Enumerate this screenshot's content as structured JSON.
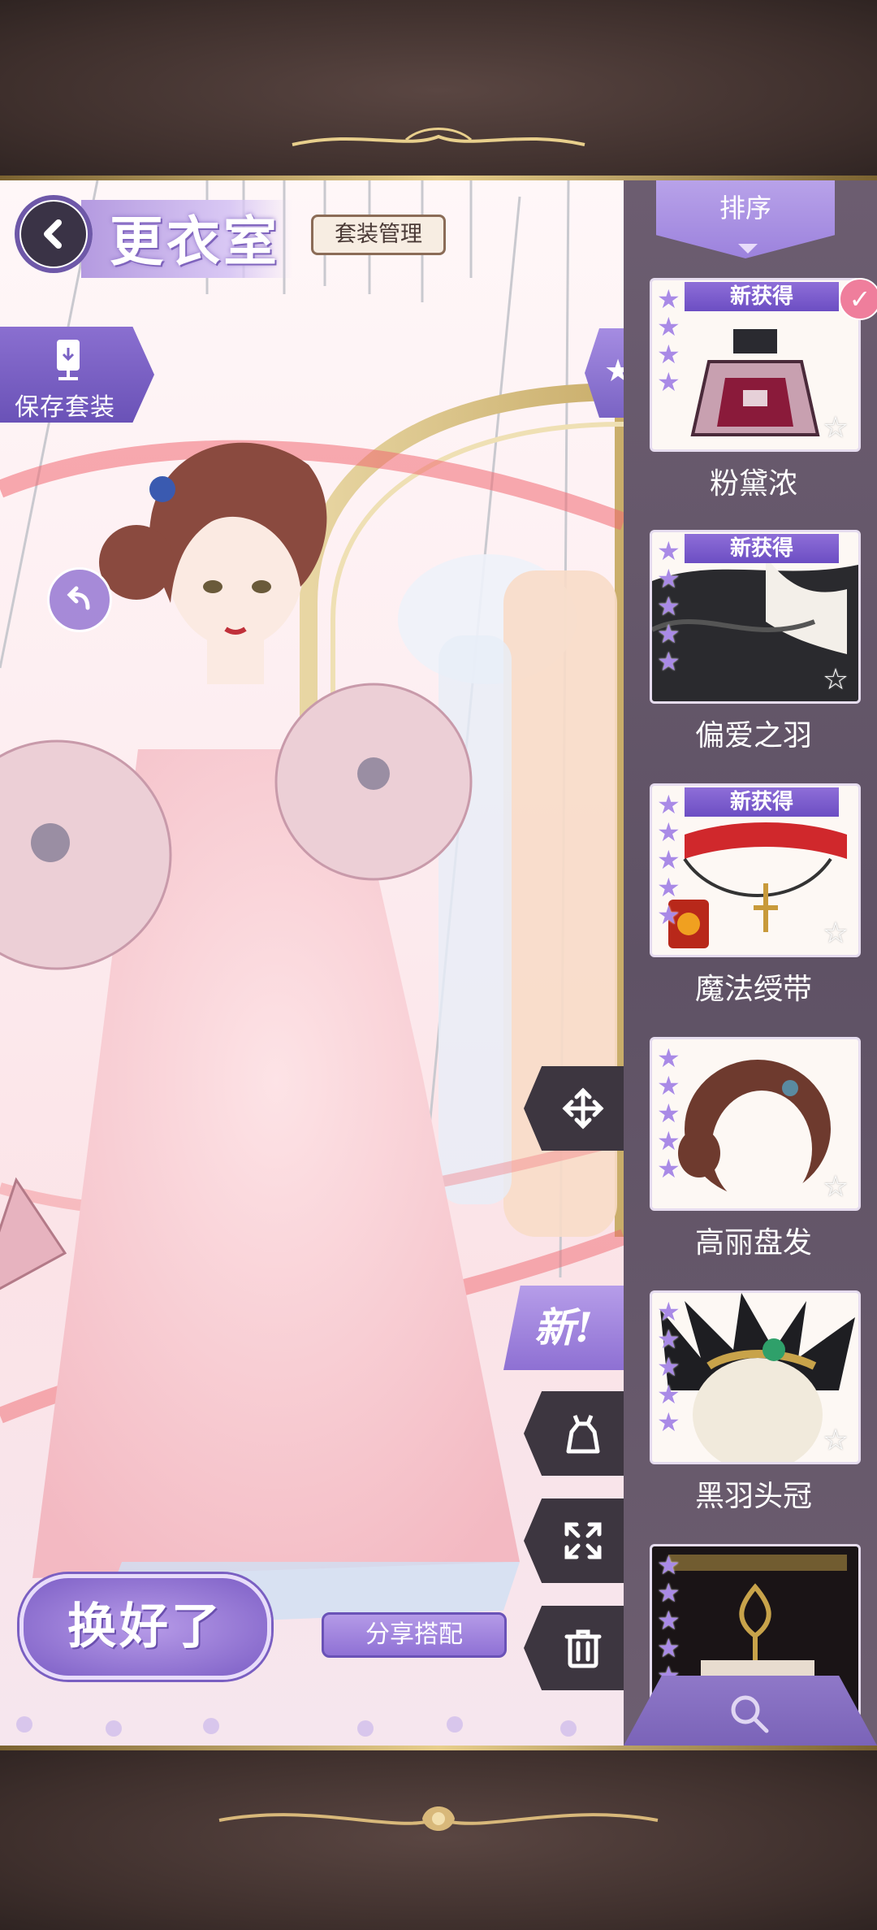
{
  "header": {
    "title": "更衣室",
    "suit_manage": "套装管理"
  },
  "left_tools": {
    "save_suit": "保存套装"
  },
  "side_buttons": {
    "new_label": "新!"
  },
  "bottom": {
    "done": "换好了",
    "share": "分享搭配"
  },
  "panel": {
    "sort_label": "排序",
    "new_badge": "新获得",
    "items": [
      {
        "name": "粉黛浓",
        "stars": 4,
        "is_new": true,
        "selected": true,
        "art": "perfume-bottle"
      },
      {
        "name": "偏爱之羽",
        "stars": 5,
        "is_new": true,
        "selected": false,
        "art": "black-feather-cape"
      },
      {
        "name": "魔法绶带",
        "stars": 5,
        "is_new": true,
        "selected": false,
        "art": "red-ribbon-collar"
      },
      {
        "name": "高丽盘发",
        "stars": 5,
        "is_new": false,
        "selected": false,
        "art": "braided-updo"
      },
      {
        "name": "黑羽头冠",
        "stars": 5,
        "is_new": false,
        "selected": false,
        "art": "black-feather-crown"
      },
      {
        "name": "",
        "stars": 5,
        "is_new": false,
        "selected": false,
        "art": "dark-hat"
      }
    ]
  },
  "colors": {
    "accent_purple": "#8e70d3",
    "frame_brown": "#3e2f2c",
    "gold": "#e8cf8c",
    "panel_bg": "#5f5265"
  }
}
